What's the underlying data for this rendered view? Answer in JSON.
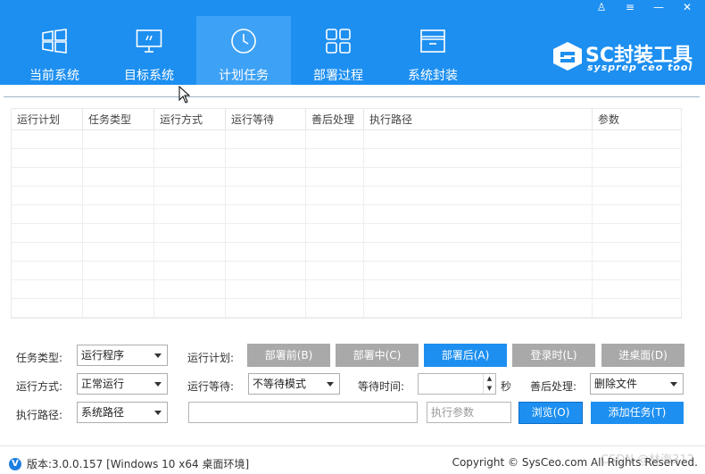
{
  "window_controls": {
    "user": "♙",
    "menu": "≡",
    "minimize": "—",
    "close": "✕"
  },
  "nav": {
    "items": [
      {
        "label": "当前系统",
        "icon": "windows-icon"
      },
      {
        "label": "目标系统",
        "icon": "monitor-icon"
      },
      {
        "label": "计划任务",
        "icon": "clock-icon",
        "active": true
      },
      {
        "label": "部署过程",
        "icon": "grid-icon"
      },
      {
        "label": "系统封装",
        "icon": "package-icon"
      }
    ]
  },
  "logo": {
    "title": "SC封装工具",
    "subtitle": "sysprep ceo tool"
  },
  "table": {
    "columns": [
      "运行计划",
      "任务类型",
      "运行方式",
      "运行等待",
      "善后处理",
      "执行路径",
      "参数"
    ],
    "rows": []
  },
  "form": {
    "task_type_label": "任务类型:",
    "task_type_value": "运行程序",
    "run_mode_label": "运行方式:",
    "run_mode_value": "正常运行",
    "exec_path_label": "执行路径:",
    "exec_path_value": "系统路径",
    "run_plan_label": "运行计划:",
    "run_wait_label": "运行等待:",
    "run_wait_value": "不等待模式",
    "wait_time_label": "等待时间:",
    "wait_time_unit": "秒",
    "after_label": "善后处理:",
    "after_value": "删除文件",
    "path_input_value": "",
    "params_placeholder": "执行参数",
    "plan_buttons": {
      "before": "部署前(B)",
      "during": "部署中(C)",
      "after": "部署后(A)",
      "login": "登录时(L)",
      "desktop": "进桌面(D)"
    },
    "browse_button": "浏览(O)",
    "add_task_button": "添加任务(T)"
  },
  "footer": {
    "version_badge": "V",
    "version_text": "版本:3.0.0.157 [Windows 10 x64 桌面环境]",
    "copyright": "Copyright © SysCeo.com All Rights Reserved.",
    "watermark": "CSDN @林海312"
  },
  "colors": {
    "header": "#1d8ff0",
    "active_tab": "#3da1f5",
    "gray_button": "#a9a9a9",
    "blue_button": "#1d8ff0"
  }
}
